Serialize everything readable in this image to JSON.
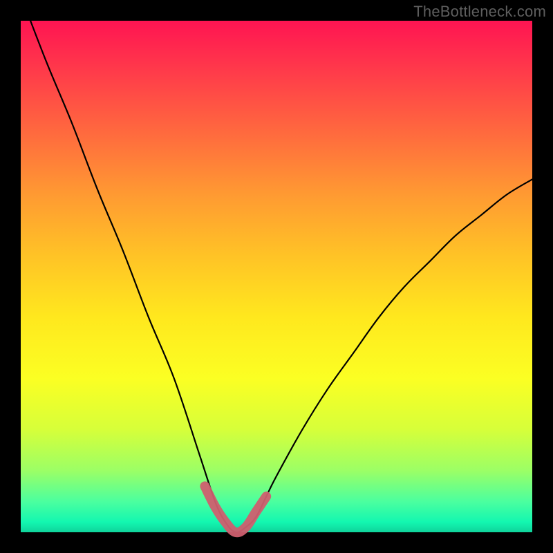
{
  "watermark": "TheBottleneck.com",
  "colors": {
    "frame": "#000000",
    "watermark": "#5e5e5e",
    "curve_stroke": "#000000",
    "highlight_stroke": "#cf5f6f",
    "gradient_stops": [
      "#ff1452",
      "#ff3b4a",
      "#ff6a3e",
      "#ff9a32",
      "#ffc326",
      "#ffe81e",
      "#fbff23",
      "#d6ff3a",
      "#9bff66",
      "#4bff9f",
      "#13f7b0",
      "#0fd39b"
    ]
  },
  "chart_data": {
    "type": "line",
    "title": "",
    "xlabel": "",
    "ylabel": "",
    "xlim": [
      0,
      100
    ],
    "ylim": [
      0,
      100
    ],
    "note": "V-shaped bottleneck curve. x is roughly a component balance ratio; y is bottleneck percent. Minimum near x≈42 where bottleneck≈0. Pink highlight marks the near-zero sweet-spot band (x≈36–48, y<≈5).",
    "series": [
      {
        "name": "bottleneck-curve",
        "x": [
          0,
          5,
          10,
          15,
          20,
          25,
          30,
          35,
          38,
          40,
          42,
          44,
          46,
          48,
          50,
          55,
          60,
          65,
          70,
          75,
          80,
          85,
          90,
          95,
          100
        ],
        "y": [
          105,
          92,
          80,
          67,
          55,
          42,
          30,
          15,
          6,
          2,
          0,
          1,
          3,
          7,
          11,
          20,
          28,
          35,
          42,
          48,
          53,
          58,
          62,
          66,
          69
        ]
      },
      {
        "name": "sweet-spot-highlight",
        "x": [
          36,
          38,
          40,
          42,
          44,
          46,
          48
        ],
        "y": [
          9,
          5,
          2,
          0,
          1,
          4,
          7
        ]
      }
    ]
  }
}
